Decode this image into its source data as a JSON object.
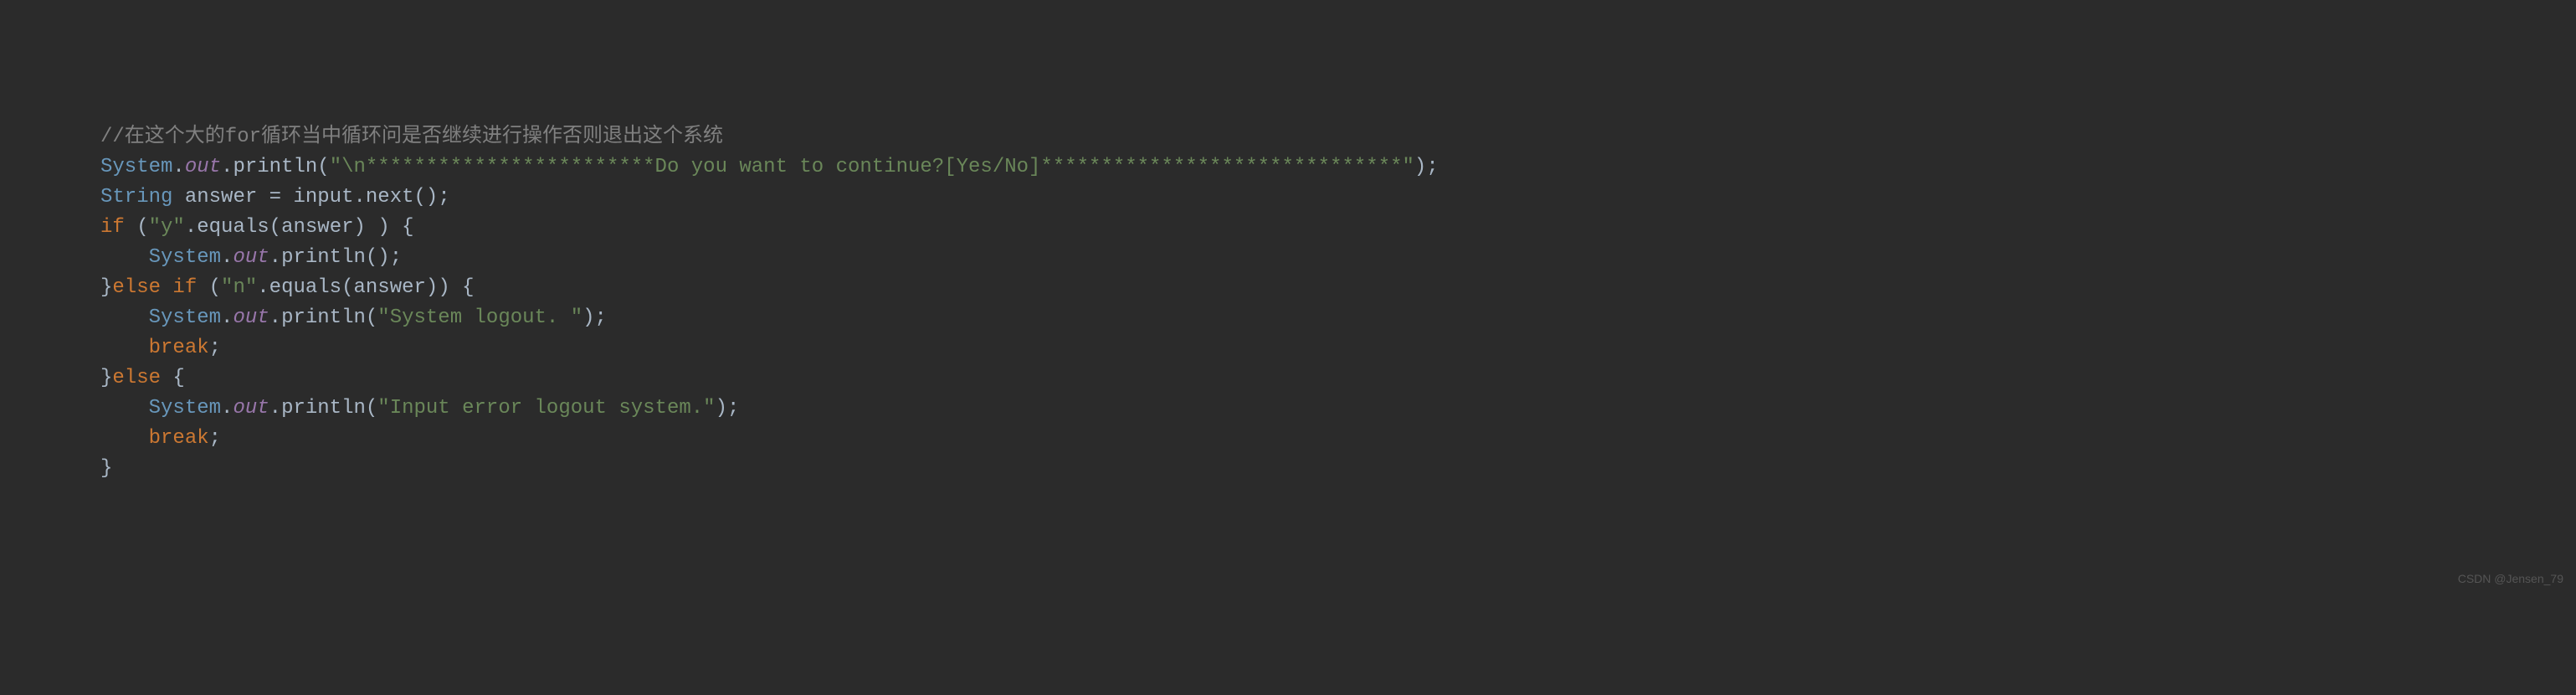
{
  "code": {
    "line1": {
      "comment": "//在这个大的for循环当中循环问是否继续进行操作否则退出这个系统"
    },
    "line2": {
      "class": "System",
      "dot1": ".",
      "field": "out",
      "dot2": ".",
      "method": "println",
      "paren_open": "(",
      "string": "\"\\n************************Do you want to continue?[Yes/No]******************************\"",
      "paren_close": ")",
      "semi": ";"
    },
    "line3": {
      "type": "String",
      "space1": " ",
      "var": "answer",
      "space2": " ",
      "op": "=",
      "space3": " ",
      "obj": "input",
      "dot": ".",
      "method": "next",
      "parens": "()",
      "semi": ";"
    },
    "line4": {
      "kw_if": "if",
      "space1": " ",
      "paren_open": "(",
      "string": "\"y\"",
      "dot": ".",
      "method": "equals",
      "paren2_open": "(",
      "arg": "answer",
      "paren2_close": ")",
      "space2": " ",
      "paren_close": ")",
      "space3": " ",
      "brace": "{"
    },
    "line5": {
      "indent": "    ",
      "class": "System",
      "dot1": ".",
      "field": "out",
      "dot2": ".",
      "method": "println",
      "parens": "()",
      "semi": ";"
    },
    "line6": {
      "brace_close": "}",
      "kw_else": "else",
      "space1": " ",
      "kw_if": "if",
      "space2": " ",
      "paren_open": "(",
      "string": "\"n\"",
      "dot": ".",
      "method": "equals",
      "paren2_open": "(",
      "arg": "answer",
      "paren2_close": ")",
      "paren_close": ")",
      "space3": " ",
      "brace": "{"
    },
    "line7": {
      "indent": "    ",
      "class": "System",
      "dot1": ".",
      "field": "out",
      "dot2": ".",
      "method": "println",
      "paren_open": "(",
      "string": "\"System logout. \"",
      "paren_close": ")",
      "semi": ";"
    },
    "line8": {
      "indent": "    ",
      "kw": "break",
      "semi": ";"
    },
    "line9": {
      "brace_close": "}",
      "kw_else": "else",
      "space": " ",
      "brace": "{"
    },
    "line10": {
      "indent": "    ",
      "class": "System",
      "dot1": ".",
      "field": "out",
      "dot2": ".",
      "method": "println",
      "paren_open": "(",
      "string": "\"Input error logout system.\"",
      "paren_close": ")",
      "semi": ";"
    },
    "line11": {
      "indent": "    ",
      "kw": "break",
      "semi": ";"
    },
    "line12": {
      "brace": "}"
    }
  },
  "watermark": "CSDN @Jensen_79"
}
